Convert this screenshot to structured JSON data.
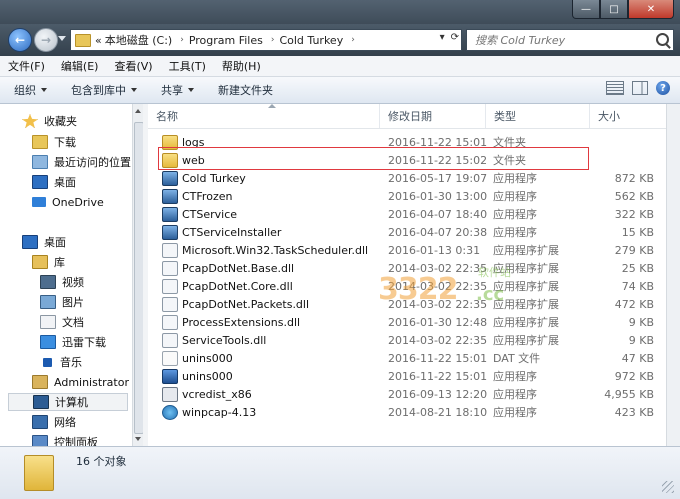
{
  "window": {
    "controls": {
      "minimize": "—",
      "maximize": "□",
      "close": "✕"
    }
  },
  "address": {
    "overflow": "«",
    "crumbs": [
      "本地磁盘 (C:)",
      "Program Files",
      "Cold Turkey"
    ],
    "search_placeholder": "搜索 Cold Turkey"
  },
  "menu": [
    "文件(F)",
    "编辑(E)",
    "查看(V)",
    "工具(T)",
    "帮助(H)"
  ],
  "toolbar": {
    "organize": "组织",
    "include": "包含到库中",
    "share": "共享",
    "new_folder": "新建文件夹",
    "help": "?"
  },
  "sidebar": [
    {
      "label": "收藏夹",
      "icon": "star-icon"
    },
    {
      "label": "下载",
      "icon": "downloads-folder-icon"
    },
    {
      "label": "最近访问的位置",
      "icon": "recent-places-icon"
    },
    {
      "label": "桌面",
      "icon": "desktop-icon"
    },
    {
      "label": "OneDrive",
      "icon": "cloud-icon"
    },
    {
      "label": "桌面",
      "icon": "desktop-icon"
    },
    {
      "label": "库",
      "icon": "library-icon"
    },
    {
      "label": "视频",
      "icon": "video-icon"
    },
    {
      "label": "图片",
      "icon": "pictures-icon"
    },
    {
      "label": "文档",
      "icon": "documents-icon"
    },
    {
      "label": "迅雷下载",
      "icon": "thunder-icon"
    },
    {
      "label": "音乐",
      "icon": "music-icon"
    },
    {
      "label": "Administrator",
      "icon": "user-folder-icon"
    },
    {
      "label": "计算机",
      "icon": "computer-icon"
    },
    {
      "label": "网络",
      "icon": "network-icon"
    },
    {
      "label": "控制面板",
      "icon": "control-panel-icon"
    }
  ],
  "columns": {
    "name": "名称",
    "date": "修改日期",
    "type": "类型",
    "size": "大小"
  },
  "files": [
    {
      "name": "logs",
      "date": "2016-11-22 15:01",
      "type": "文件夹",
      "size": "",
      "icon": "folder"
    },
    {
      "name": "web",
      "date": "2016-11-22 15:02",
      "type": "文件夹",
      "size": "",
      "icon": "folder"
    },
    {
      "name": "Cold Turkey",
      "date": "2016-05-17 19:07",
      "type": "应用程序",
      "size": "872 KB",
      "icon": "app"
    },
    {
      "name": "CTFrozen",
      "date": "2016-01-30 13:00",
      "type": "应用程序",
      "size": "562 KB",
      "icon": "app"
    },
    {
      "name": "CTService",
      "date": "2016-04-07 18:40",
      "type": "应用程序",
      "size": "322 KB",
      "icon": "app"
    },
    {
      "name": "CTServiceInstaller",
      "date": "2016-04-07 20:38",
      "type": "应用程序",
      "size": "15 KB",
      "icon": "app"
    },
    {
      "name": "Microsoft.Win32.TaskScheduler.dll",
      "date": "2016-01-13 0:31",
      "type": "应用程序扩展",
      "size": "279 KB",
      "icon": "dll"
    },
    {
      "name": "PcapDotNet.Base.dll",
      "date": "2014-03-02 22:35",
      "type": "应用程序扩展",
      "size": "25 KB",
      "icon": "dll"
    },
    {
      "name": "PcapDotNet.Core.dll",
      "date": "2014-03-02 22:35",
      "type": "应用程序扩展",
      "size": "74 KB",
      "icon": "dll"
    },
    {
      "name": "PcapDotNet.Packets.dll",
      "date": "2014-03-02 22:35",
      "type": "应用程序扩展",
      "size": "472 KB",
      "icon": "dll"
    },
    {
      "name": "ProcessExtensions.dll",
      "date": "2016-01-30 12:48",
      "type": "应用程序扩展",
      "size": "9 KB",
      "icon": "dll"
    },
    {
      "name": "ServiceTools.dll",
      "date": "2014-03-02 22:35",
      "type": "应用程序扩展",
      "size": "9 KB",
      "icon": "dll"
    },
    {
      "name": "unins000",
      "date": "2016-11-22 15:01",
      "type": "DAT 文件",
      "size": "47 KB",
      "icon": "dat"
    },
    {
      "name": "unins000",
      "date": "2016-11-22 15:01",
      "type": "应用程序",
      "size": "972 KB",
      "icon": "uninstaller"
    },
    {
      "name": "vcredist_x86",
      "date": "2016-09-13 12:20",
      "type": "应用程序",
      "size": "4,955 KB",
      "icon": "vcredist"
    },
    {
      "name": "winpcap-4.13",
      "date": "2014-08-21 18:10",
      "type": "应用程序",
      "size": "423 KB",
      "icon": "winpcap"
    }
  ],
  "watermark": {
    "main": "3322",
    "suffix": ".cc",
    "small": "软件站"
  },
  "status": {
    "count": "16 个对象"
  }
}
